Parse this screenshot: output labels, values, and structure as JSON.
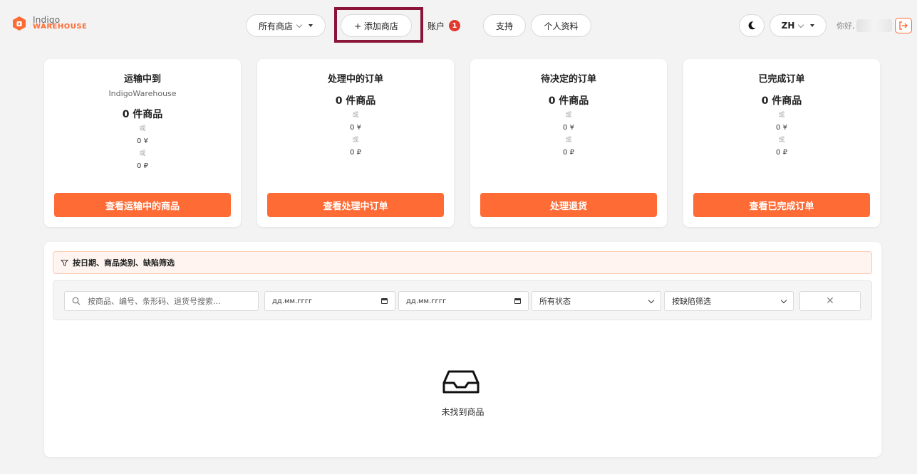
{
  "header": {
    "logo_line1": "Indigo",
    "logo_line2": "WAREHOUSE",
    "stores_label": "所有商店",
    "add_store_label": "+ 添加商店",
    "account_label": "账户",
    "account_badge": "1",
    "support_label": "支持",
    "profile_label": "个人资料",
    "lang_label": "ZH",
    "greeting": "你好,",
    "theme_icon": "moon-icon",
    "logout_icon": "logout-icon"
  },
  "cards": [
    {
      "title": "运输中到",
      "subtitle": "IndigoWarehouse",
      "count": "0 件商品",
      "or": "或",
      "rmb": "0 ¥",
      "rub": "0 ₽",
      "button": "查看运输中的商品"
    },
    {
      "title": "处理中的订单",
      "count": "0 件商品",
      "or": "或",
      "rmb": "0 ¥",
      "rub": "0 ₽",
      "button": "查看处理中订单"
    },
    {
      "title": "待决定的订单",
      "count": "0 件商品",
      "or": "或",
      "rmb": "0 ¥",
      "rub": "0 ₽",
      "button": "处理退货"
    },
    {
      "title": "已完成订单",
      "count": "0 件商品",
      "or": "或",
      "rmb": "0 ¥",
      "rub": "0 ₽",
      "button": "查看已完成订单"
    }
  ],
  "filters": {
    "banner": "按日期、商品类别、缺陷筛选",
    "search_placeholder": "按商品、编号、条形码、退货号搜索...",
    "date_from": "дд.мм.гггг",
    "date_to": "дд.мм.гггг",
    "status": "所有状态",
    "defect": "按缺陷筛选",
    "clear": "✕"
  },
  "empty": {
    "message": "未找到商品",
    "icon": "inbox-icon"
  },
  "colors": {
    "accent": "#ff6b35",
    "badge": "#e23a2e",
    "highlight": "#8a1538"
  }
}
